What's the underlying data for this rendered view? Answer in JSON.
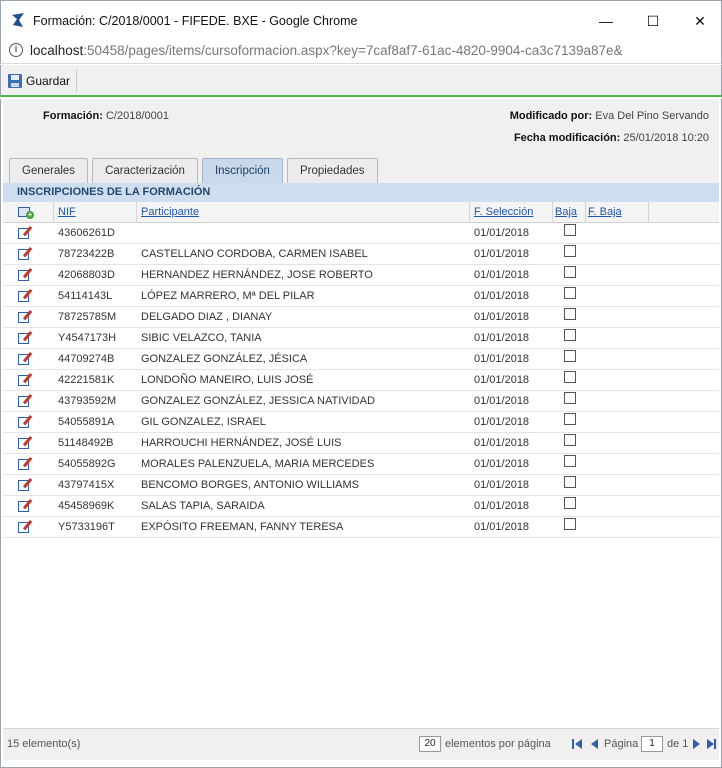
{
  "window": {
    "title": "Formación: C/2018/0001 - FIFEDE. BXE - Google Chrome",
    "min_glyph": "—",
    "max_glyph": "☐",
    "close_glyph": "✕"
  },
  "address": {
    "host": "localhost",
    "path": ":50458/pages/items/cursoformacion.aspx?key=7caf8af7-61ac-4820-9904-ca3c7139a87e&"
  },
  "toolbar": {
    "save_label": "Guardar"
  },
  "header": {
    "formacion_label": "Formación:",
    "formacion_value": "C/2018/0001",
    "modificado_label": "Modificado por:",
    "modificado_value": "Eva Del Pino Servando",
    "fecha_label": "Fecha modificación:",
    "fecha_value": "25/01/2018 10:20"
  },
  "tabs": [
    "Generales",
    "Caracterización",
    "Inscripción",
    "Propiedades"
  ],
  "active_tab": "Inscripción",
  "section_title": "INSCRIPCIONES DE LA FORMACIÓN",
  "grid": {
    "columns": {
      "nif": "NIF",
      "participante": "Participante",
      "f_seleccion": "F. Selección",
      "baja": "Baja",
      "f_baja": "F. Baja"
    },
    "rows": [
      {
        "nif": "43606261D",
        "participante": "",
        "f_seleccion": "01/01/2018"
      },
      {
        "nif": "78723422B",
        "participante": "CASTELLANO CORDOBA, CARMEN ISABEL",
        "f_seleccion": "01/01/2018"
      },
      {
        "nif": "42068803D",
        "participante": "HERNANDEZ HERNÁNDEZ, JOSE ROBERTO",
        "f_seleccion": "01/01/2018"
      },
      {
        "nif": "54114143L",
        "participante": "LÓPEZ MARRERO, Mª DEL PILAR",
        "f_seleccion": "01/01/2018"
      },
      {
        "nif": "78725785M",
        "participante": "DELGADO DIAZ , DIANAY",
        "f_seleccion": "01/01/2018"
      },
      {
        "nif": "Y4547173H",
        "participante": "SIBIC VELAZCO, TANIA",
        "f_seleccion": "01/01/2018"
      },
      {
        "nif": "44709274B",
        "participante": "GONZALEZ GONZÁLEZ, JÉSICA",
        "f_seleccion": "01/01/2018"
      },
      {
        "nif": "42221581K",
        "participante": "LONDOÑO MANEIRO, LUIS JOSÉ",
        "f_seleccion": "01/01/2018"
      },
      {
        "nif": "43793592M",
        "participante": "GONZALEZ GONZÁLEZ, JESSICA NATIVIDAD",
        "f_seleccion": "01/01/2018"
      },
      {
        "nif": "54055891A",
        "participante": "GIL GONZALEZ, ISRAEL",
        "f_seleccion": "01/01/2018"
      },
      {
        "nif": "51148492B",
        "participante": "HARROUCHI HERNÁNDEZ, JOSÉ LUIS",
        "f_seleccion": "01/01/2018"
      },
      {
        "nif": "54055892G",
        "participante": "MORALES PALENZUELA, MARIA MERCEDES",
        "f_seleccion": "01/01/2018"
      },
      {
        "nif": "43797415X",
        "participante": "BENCOMO BORGES, ANTONIO WILLIAMS",
        "f_seleccion": "01/01/2018"
      },
      {
        "nif": "45458969K",
        "participante": "SALAS TAPIA, SARAIDA",
        "f_seleccion": "01/01/2018"
      },
      {
        "nif": "Y5733196T",
        "participante": "EXPÓSITO FREEMAN, FANNY TERESA",
        "f_seleccion": "01/01/2018"
      }
    ]
  },
  "footer": {
    "count": "15 elemento(s)",
    "page_size": "20",
    "per_page_label": "elementos por página",
    "page_label": "Página",
    "page_value": "1",
    "of_label": "de 1"
  },
  "colors": {
    "accent": "#48b848",
    "tab_active": "#c9d9ea",
    "link": "#1f57a8",
    "icon_blue": "#2d5fa6"
  }
}
